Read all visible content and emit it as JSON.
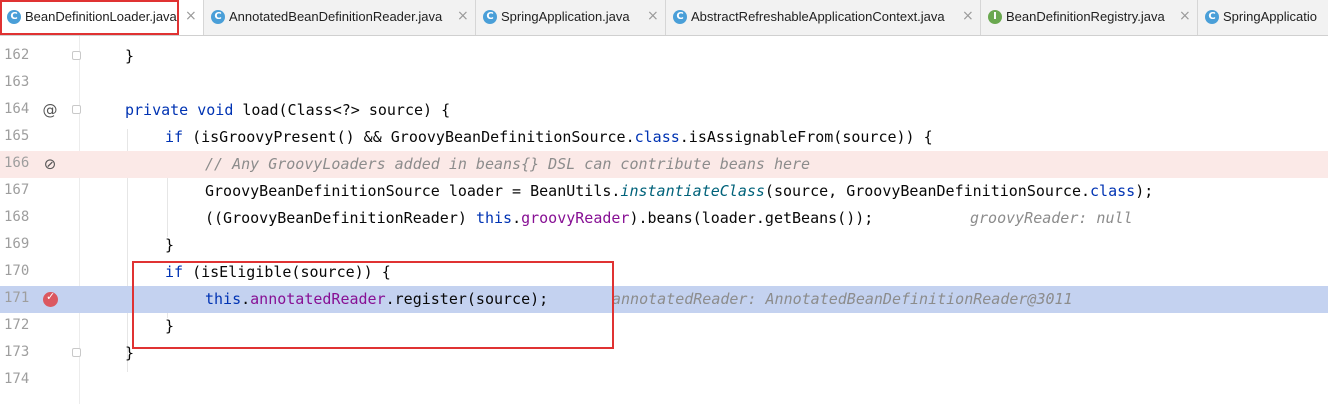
{
  "tabs": [
    {
      "label": "BeanDefinitionLoader.java",
      "icon": "C"
    },
    {
      "label": "AnnotatedBeanDefinitionReader.java",
      "icon": "C"
    },
    {
      "label": "SpringApplication.java",
      "icon": "C"
    },
    {
      "label": "AbstractRefreshableApplicationContext.java",
      "icon": "C"
    },
    {
      "label": "BeanDefinitionRegistry.java",
      "icon": "I"
    },
    {
      "label": "SpringApplicatio",
      "icon": "C"
    }
  ],
  "close_glyph": "×",
  "gutter_icons": {
    "at": "@",
    "disabled": "⊘",
    "check": "✓"
  },
  "lines": [
    {
      "num": "162",
      "parts": [
        "}"
      ]
    },
    {
      "num": "163",
      "parts": [
        ""
      ]
    },
    {
      "num": "164",
      "parts": [
        "private",
        " ",
        "void",
        " load(Class<?> source) {"
      ]
    },
    {
      "num": "165",
      "parts": [
        "if",
        " (isGroovyPresent() && GroovyBeanDefinitionSource.",
        "class",
        ".isAssignableFrom(source)) {"
      ]
    },
    {
      "num": "166",
      "parts": [
        "// Any GroovyLoaders added in beans{} DSL can contribute beans here"
      ]
    },
    {
      "num": "167",
      "parts": [
        "GroovyBeanDefinitionSource loader = BeanUtils.",
        "instantiateClass",
        "(source, GroovyBeanDefinitionSource.",
        "class",
        ");"
      ]
    },
    {
      "num": "168",
      "parts": [
        "((GroovyBeanDefinitionReader) ",
        "this",
        ".",
        "groovyReader",
        ").beans(loader.getBeans());",
        "groovyReader: null"
      ]
    },
    {
      "num": "169",
      "parts": [
        "}"
      ]
    },
    {
      "num": "170",
      "parts": [
        "if",
        " (isEligible(source)) {"
      ]
    },
    {
      "num": "171",
      "parts": [
        "this",
        ".",
        "annotatedReader",
        ".register(source);",
        "annotatedReader: AnnotatedBeanDefinitionReader@3011"
      ]
    },
    {
      "num": "172",
      "parts": [
        "}"
      ]
    },
    {
      "num": "173",
      "parts": [
        "}"
      ]
    },
    {
      "num": "174",
      "parts": [
        ""
      ]
    }
  ]
}
